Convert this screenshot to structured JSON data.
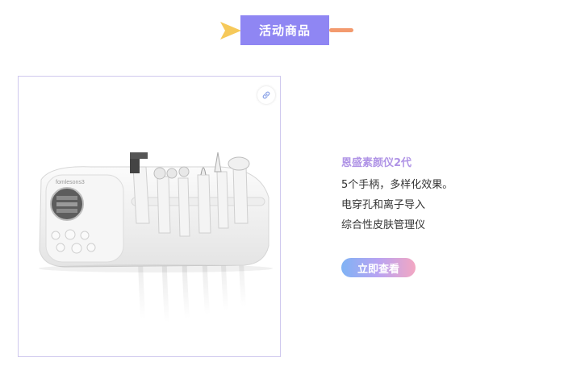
{
  "header": {
    "title": "活动商品",
    "accent_color": "#8f86f3",
    "arrow_color": "#f6c95a",
    "dash_color": "#f39a6e",
    "arrow_icon": "arrow-right-icon"
  },
  "product": {
    "image_icon": "link-icon",
    "device_brand": "fomlesons3",
    "name": "恩盛素颜仪2代",
    "description": [
      "5个手柄，多样化效果。",
      "电穿孔和离子导入",
      "综合性皮肤管理仪"
    ],
    "cta_label": "立即查看"
  }
}
